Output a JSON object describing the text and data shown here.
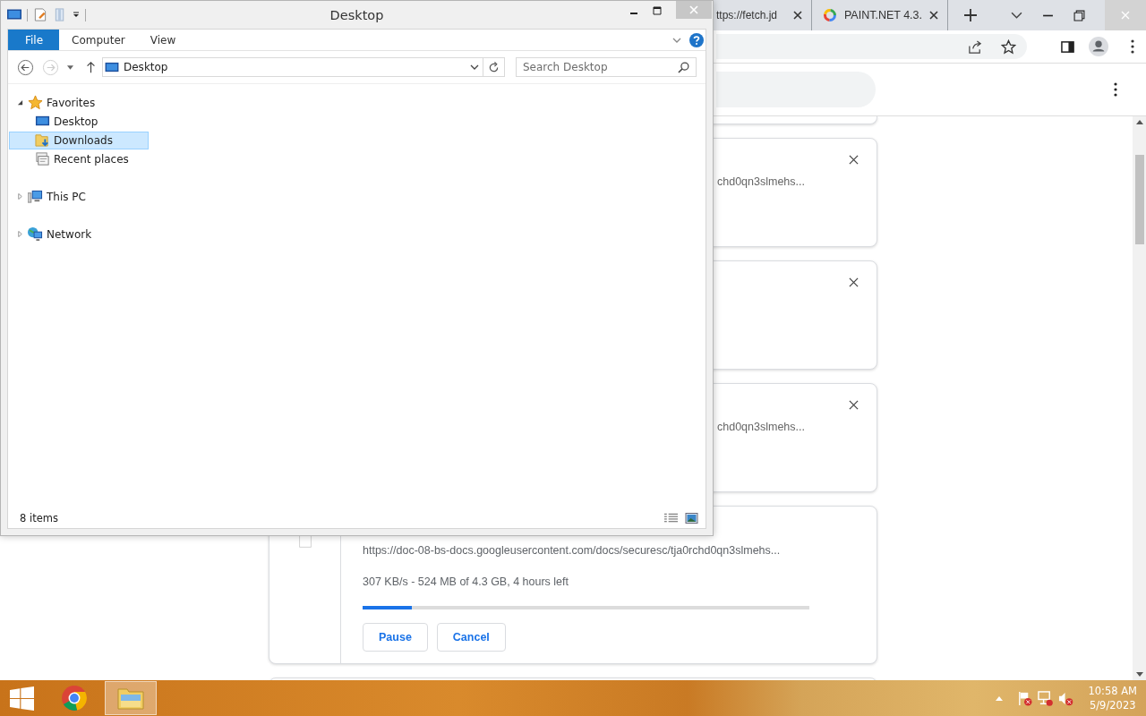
{
  "browser": {
    "tabs": [
      {
        "title": "ttps://fetch.jd",
        "kind": "plain"
      },
      {
        "title": "PAINT.NET 4.3.",
        "kind": "ring"
      }
    ],
    "downloads": [
      {
        "kind": "tail"
      },
      {
        "kind": "partial",
        "url": "chd0qn3slmehs..."
      },
      {
        "kind": "empty"
      },
      {
        "kind": "partial",
        "url": "chd0qn3slmehs..."
      },
      {
        "kind": "active",
        "url": "https://doc-08-bs-docs.googleusercontent.com/docs/securesc/tja0rchd0qn3slmehs...",
        "status": "307 KB/s - 524 MB of 4.3 GB, 4 hours left",
        "level": 0.11,
        "buttons": [
          "Pause",
          "Cancel"
        ]
      }
    ]
  },
  "explorer": {
    "title": "Desktop",
    "ribbon_tabs": [
      {
        "label": "File",
        "selected": true
      },
      {
        "label": "Computer",
        "selected": false
      },
      {
        "label": "View",
        "selected": false
      }
    ],
    "address": "Desktop",
    "search": {
      "placeholder": "Search Desktop"
    },
    "tree": [
      {
        "label": "Favorites",
        "kind": "star",
        "expanded": true,
        "selected": false,
        "children": [
          {
            "label": "Desktop",
            "kind": "desktop",
            "selected": false
          },
          {
            "label": "Downloads",
            "kind": "downloads",
            "selected": true
          },
          {
            "label": "Recent places",
            "kind": "recent",
            "selected": false
          }
        ]
      },
      {
        "label": "This PC",
        "kind": "pc",
        "expanded": false,
        "selected": false
      },
      {
        "label": "Network",
        "kind": "network",
        "expanded": false,
        "selected": false
      }
    ],
    "status": "8 items"
  },
  "taskbar": {
    "apps": [
      {
        "kind": "browser",
        "selected": false
      },
      {
        "kind": "folder",
        "selected": true
      }
    ],
    "time": "10:58 AM",
    "date": "5/9/2023"
  }
}
